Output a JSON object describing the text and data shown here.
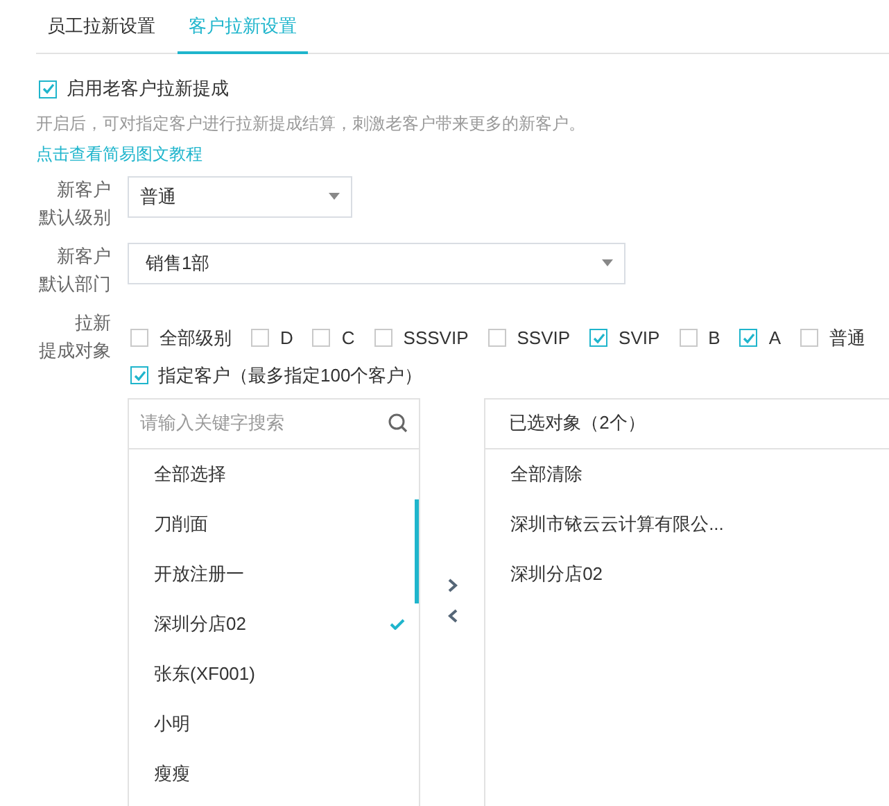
{
  "tabs": [
    {
      "label": "员工拉新设置",
      "selected": false
    },
    {
      "label": "客户拉新设置",
      "selected": true
    }
  ],
  "enable": {
    "label": "启用老客户拉新提成",
    "checked": true
  },
  "description": "开启后，可对指定客户进行拉新提成结算，刺激老客户带来更多的新客户。",
  "tutorial_link": "点击查看简易图文教程",
  "default_level": {
    "label": [
      "新客户",
      "默认级别"
    ],
    "value": "普通"
  },
  "default_department": {
    "label": [
      "新客户",
      "默认部门"
    ],
    "value": "销售1部"
  },
  "targets": {
    "label": [
      "拉新",
      "提成对象"
    ],
    "levels": [
      {
        "label": "全部级别",
        "checked": false
      },
      {
        "label": "D",
        "checked": false
      },
      {
        "label": "C",
        "checked": false
      },
      {
        "label": "SSSVIP",
        "checked": false
      },
      {
        "label": "SSVIP",
        "checked": false
      },
      {
        "label": "SVIP",
        "checked": true
      },
      {
        "label": "B",
        "checked": false
      },
      {
        "label": "A",
        "checked": true
      },
      {
        "label": "普通",
        "checked": false
      }
    ],
    "specified": {
      "label": "指定客户（最多指定100个客户）",
      "checked": true
    }
  },
  "source_panel": {
    "placeholder": "请输入关键字搜索",
    "select_all": "全部选择",
    "items": [
      {
        "label": "刀削面",
        "selected": false
      },
      {
        "label": "开放注册一",
        "selected": false
      },
      {
        "label": "深圳分店02",
        "selected": true
      },
      {
        "label": "张东(XF001)",
        "selected": false
      },
      {
        "label": "小明",
        "selected": false
      },
      {
        "label": "瘦瘦",
        "selected": false
      }
    ]
  },
  "target_panel": {
    "title": "已选对象（2个）",
    "clear_all": "全部清除",
    "items": [
      "深圳市铱云云计算有限公...",
      "深圳分店02"
    ]
  }
}
